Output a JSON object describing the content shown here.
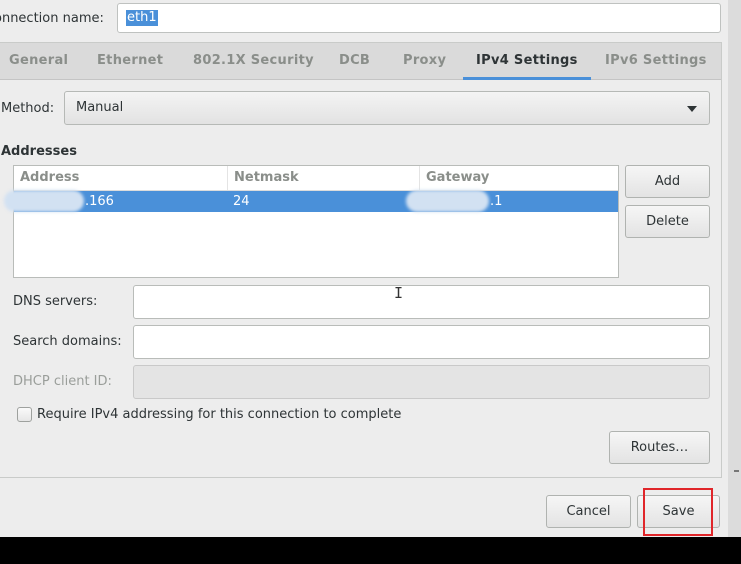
{
  "connection": {
    "label": "onnection name:",
    "value": "eth1"
  },
  "tabs": [
    {
      "label": "General"
    },
    {
      "label": "Ethernet"
    },
    {
      "label": "802.1X Security"
    },
    {
      "label": "DCB"
    },
    {
      "label": "Proxy"
    },
    {
      "label": "IPv4 Settings"
    },
    {
      "label": "IPv6 Settings"
    }
  ],
  "active_tab": "IPv4 Settings",
  "method": {
    "label": "Method:",
    "value": "Manual"
  },
  "addresses": {
    "title": "Addresses",
    "columns": [
      "Address",
      "Netmask",
      "Gateway"
    ],
    "row": {
      "address": ".166",
      "netmask": "24",
      "gateway": ".1"
    },
    "add_label": "Add",
    "delete_label": "Delete"
  },
  "dns": {
    "label": "DNS servers:",
    "value": ""
  },
  "search_domains": {
    "label": "Search domains:",
    "value": ""
  },
  "dhcp_client_id": {
    "label": "DHCP client ID:",
    "value": ""
  },
  "require_ipv4": {
    "label": "Require IPv4 addressing for this connection to complete",
    "checked": false
  },
  "routes_label": "Routes…",
  "footer": {
    "cancel_label": "Cancel",
    "save_label": "Save"
  },
  "colors": {
    "accent": "#4a90d9",
    "highlight_box": "#e0262a"
  }
}
